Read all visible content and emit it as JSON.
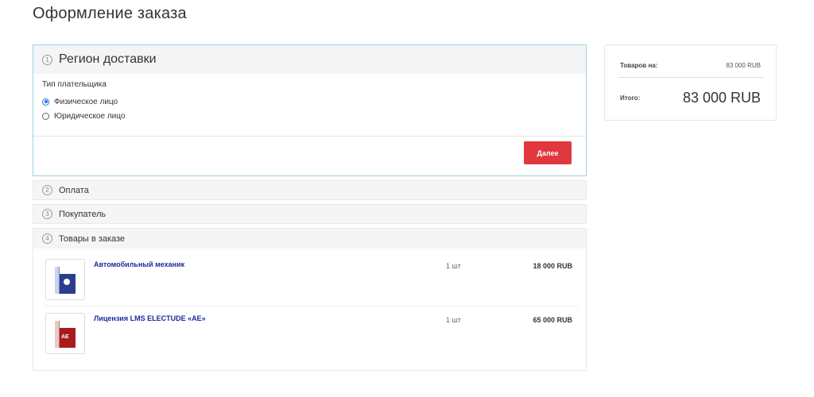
{
  "page": {
    "title": "Оформление заказа"
  },
  "steps": {
    "region": {
      "number": "1",
      "title": "Регион доставки",
      "payer_type_label": "Тип плательщика",
      "options": [
        {
          "label": "Физическое лицо",
          "selected": true
        },
        {
          "label": "Юридическое лицо",
          "selected": false
        }
      ],
      "next_label": "Далее"
    },
    "payment": {
      "number": "2",
      "title": "Оплата"
    },
    "buyer": {
      "number": "3",
      "title": "Покупатель"
    },
    "goods": {
      "number": "4",
      "title": "Товары в заказе",
      "items": [
        {
          "name": "Автомобильный механик",
          "qty": "1 шт",
          "price": "18 000 RUB",
          "thumb_icon": "product-box-blue-icon"
        },
        {
          "name": "Лицензия LMS ELECTUDE «AE»",
          "qty": "1 шт",
          "price": "65 000 RUB",
          "thumb_icon": "product-box-red-icon",
          "thumb_text": "AE"
        }
      ]
    }
  },
  "summary": {
    "goods_label": "Товаров на:",
    "goods_value": "83 000 RUB",
    "total_label": "Итого:",
    "total_value": "83 000 RUB"
  },
  "colors": {
    "accent_button": "#e0383e",
    "link": "#1d2a9a",
    "active_border": "#9ecfe4",
    "radio_selected": "#1a73e8"
  }
}
